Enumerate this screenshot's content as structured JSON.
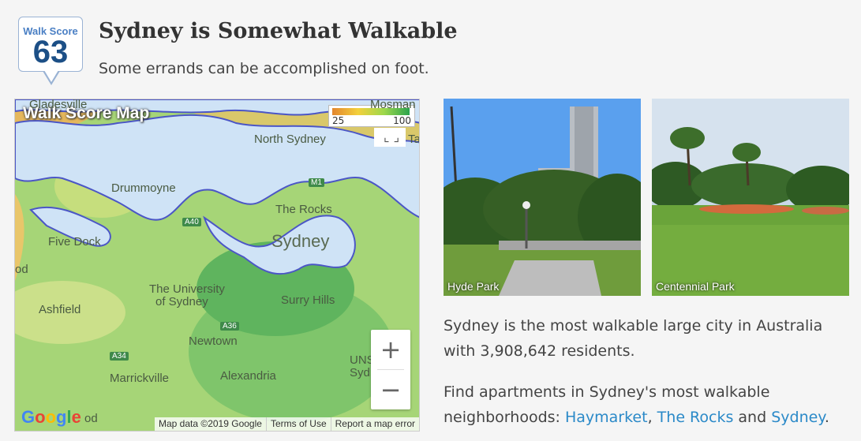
{
  "badge": {
    "label": "Walk Score",
    "score": "63"
  },
  "header": {
    "title": "Sydney is Somewhat Walkable",
    "subtitle": "Some errands can be accomplished on foot."
  },
  "map": {
    "title": "Walk Score Map",
    "legend": {
      "min": "25",
      "max": "100",
      "colors": [
        "#e3862d",
        "#f3d03c",
        "#9ed84b",
        "#2aa34d"
      ]
    },
    "labels": {
      "gladesville": "Gladesville",
      "mosman": "Mosman",
      "north_sydney": "North Sydney",
      "drummoyne": "Drummoyne",
      "the_rocks": "The Rocks",
      "five_dock": "Five Dock",
      "sydney": "Sydney",
      "university": "The University",
      "university2": "of Sydney",
      "surry_hills": "Surry Hills",
      "ashfield": "Ashfield",
      "newtown": "Newtown",
      "marrickville": "Marrickville",
      "alexandria": "Alexandria",
      "unsw": "UNSW",
      "unsw2": "Sydney",
      "bottom_left": "od",
      "left_edge": "od",
      "tay": "Ta"
    },
    "roads": {
      "m1": "M1",
      "a40": "A40",
      "a36": "A36",
      "a34": "A34"
    },
    "zoom": {
      "in": "+",
      "out": "−"
    },
    "google": "Google",
    "attribution": [
      "Map data ©2019 Google",
      "Terms of Use",
      "Report a map error"
    ]
  },
  "photos": [
    {
      "caption": "Hyde Park"
    },
    {
      "caption": "Centennial Park"
    }
  ],
  "description": {
    "text": "Sydney is the most walkable large city in Australia with 3,908,642 residents.",
    "find_prefix": "Find apartments in Sydney's most walkable neighborhoods: ",
    "link1": "Haymarket",
    "sep1": ", ",
    "link2": "The Rocks",
    "sep2": " and ",
    "link3": "Sydney",
    "end": "."
  }
}
